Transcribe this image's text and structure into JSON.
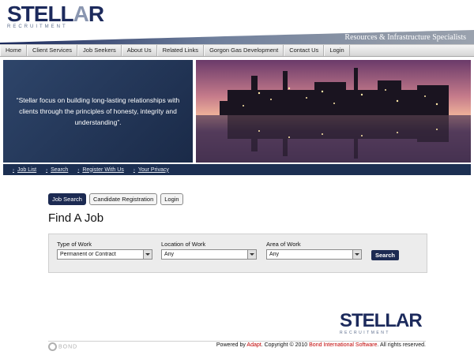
{
  "header": {
    "logo_text": "STELL",
    "logo_a": "A",
    "logo_r": "R",
    "logo_sub": "RECRUITMENT",
    "tagline": "Resources & Infrastructure Specialists"
  },
  "topnav": [
    "Home",
    "Client Services",
    "Job Seekers",
    "About Us",
    "Related Links",
    "Gorgon Gas Development",
    "Contact Us",
    "Login"
  ],
  "hero": {
    "quote": "“Stellar focus on building long-lasting relationships with clients through the principles of honesty, integrity and understanding”."
  },
  "subnav": [
    "Job List",
    "Search",
    "Register With Us",
    "Your Privacy"
  ],
  "tabs": [
    "Job Search",
    "Candidate Registration",
    "Login"
  ],
  "page_title": "Find A Job",
  "form": {
    "type_label": "Type of Work",
    "type_value": "Permanent or Contract",
    "location_label": "Location of Work",
    "location_value": "Any",
    "area_label": "Area of Work",
    "area_value": "Any",
    "search_label": "Search"
  },
  "footer": {
    "logo_text": "STELLAR",
    "logo_sub": "RECRUITMENT",
    "bond_text": "BOND",
    "powered": "Powered by ",
    "adapt": "Adapt",
    "copyright": ". Copyright © 2010 ",
    "bond_soft": "Bond International Software",
    "rights": ". All rights reserved."
  },
  "colors": {
    "brand_navy": "#1c2a52",
    "link_red": "#c00000"
  }
}
